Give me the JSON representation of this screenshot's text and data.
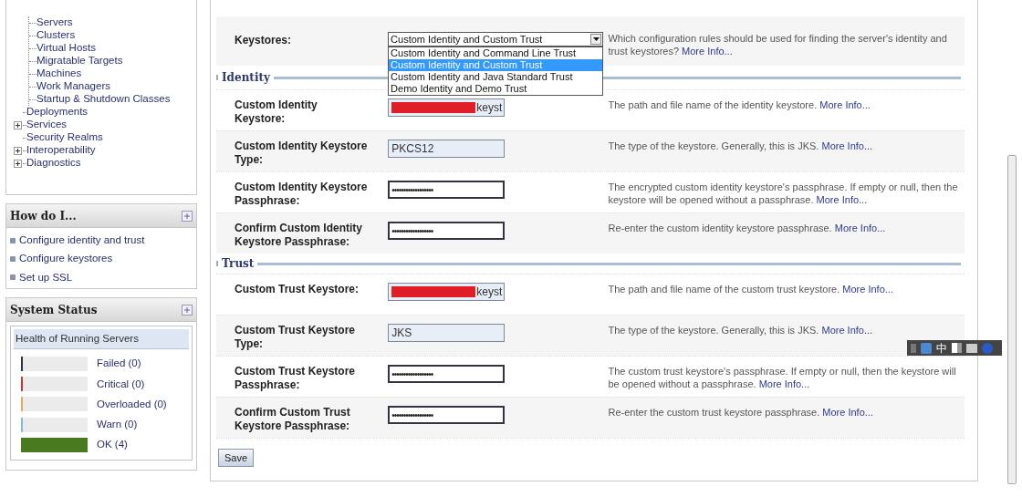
{
  "sidebar": {
    "tree": {
      "nested_items": [
        {
          "label": "Servers"
        },
        {
          "label": "Clusters"
        },
        {
          "label": "Virtual Hosts"
        },
        {
          "label": "Migratable Targets"
        },
        {
          "label": "Machines"
        },
        {
          "label": "Work Managers"
        },
        {
          "label": "Startup & Shutdown Classes"
        }
      ],
      "items": [
        {
          "label": "Deployments",
          "expandable": false
        },
        {
          "label": "Services",
          "expandable": true
        },
        {
          "label": "Security Realms",
          "expandable": false
        },
        {
          "label": "Interoperability",
          "expandable": true
        },
        {
          "label": "Diagnostics",
          "expandable": true
        }
      ]
    },
    "how_do_i": {
      "title": "How do I...",
      "links": [
        "Configure identity and trust",
        "Configure keystores",
        "Set up SSL"
      ]
    },
    "system_status": {
      "title": "System Status",
      "heading": "Health of Running Servers",
      "rows": [
        {
          "label": "Failed (0)",
          "color": "#333333",
          "level": 0
        },
        {
          "label": "Critical (0)",
          "color": "#cc3333",
          "level": 0
        },
        {
          "label": "Overloaded (0)",
          "color": "#e8a860",
          "level": 0
        },
        {
          "label": "Warn (0)",
          "color": "#88b8e0",
          "level": 0
        },
        {
          "label": "OK (4)",
          "color": "#4a7a1e",
          "level": 1
        }
      ]
    }
  },
  "form": {
    "keystores": {
      "label": "Keystores:",
      "value": "Custom Identity and Custom Trust",
      "description": "Which configuration rules should be used for finding the server's identity and trust keystores?",
      "link": "More Info...",
      "options": [
        {
          "label": "Custom Identity and Command Line Trust",
          "selected": false
        },
        {
          "label": "Custom Identity and Custom Trust",
          "selected": true
        },
        {
          "label": "Custom Identity and Java Standard Trust",
          "selected": false
        },
        {
          "label": "Demo Identity and Demo Trust",
          "selected": false
        }
      ]
    },
    "sections": [
      {
        "title": "Identity",
        "rows": [
          {
            "label": "Custom Identity Keystore:",
            "kind": "path",
            "value": "keyst",
            "redacted": true,
            "description": "The path and file name of the identity keystore.",
            "link": "More Info..."
          },
          {
            "label": "Custom Identity Keystore Type:",
            "kind": "text",
            "value": "PKCS12",
            "redacted": false,
            "description": "The type of the keystore. Generally, this is JKS.",
            "link": "More Info..."
          },
          {
            "label": "Custom Identity Keystore Passphrase:",
            "kind": "password",
            "value": "••••••••••••••••••",
            "redacted": false,
            "description": "The encrypted custom identity keystore's passphrase. If empty or null, then the keystore will be opened without a passphrase.",
            "link": "More Info..."
          },
          {
            "label": "Confirm Custom Identity Keystore Passphrase:",
            "kind": "password",
            "value": "••••••••••••••••••",
            "redacted": false,
            "description": "Re-enter the custom identity keystore passphrase.",
            "link": "More Info..."
          }
        ]
      },
      {
        "title": "Trust",
        "rows": [
          {
            "label": "Custom Trust Keystore:",
            "kind": "path",
            "value": "keyst",
            "redacted": true,
            "description": "The path and file name of the custom trust keystore.",
            "link": "More Info..."
          },
          {
            "label": "Custom Trust Keystore Type:",
            "kind": "text",
            "value": "JKS",
            "redacted": false,
            "description": "The type of the keystore. Generally, this is JKS.",
            "link": "More Info..."
          },
          {
            "label": "Custom Trust Keystore Passphrase:",
            "kind": "password",
            "value": "••••••••••••••••••",
            "redacted": false,
            "description": "The custom trust keystore's passphrase. If empty or null, then the keystore will be opened without a passphrase.",
            "link": "More Info..."
          },
          {
            "label": "Confirm Custom Trust Keystore Passphrase:",
            "kind": "password",
            "value": "••••••••••••••••••",
            "redacted": false,
            "description": "Re-enter the custom trust keystore passphrase.",
            "link": "More Info..."
          }
        ]
      }
    ],
    "save": "Save"
  },
  "ime_toolbar": {
    "mode": "中"
  }
}
